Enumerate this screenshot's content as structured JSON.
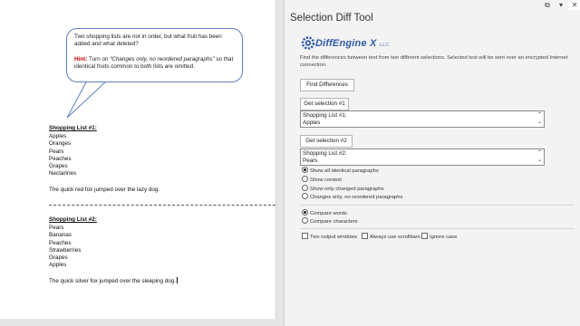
{
  "document": {
    "callout": {
      "line1": "Two shopping lists are not in order, but what fruit has been added and what deleted?",
      "hint_label": "Hint:",
      "hint_pre": " Turn on ",
      "hint_em": "“Changes only, no reordered paragraphs”",
      "hint_post": " so that identical fruits common to both lists are omitted."
    },
    "list1": {
      "heading": "Shopping List #1:",
      "items": [
        "Apples",
        "Oranges",
        "Pears",
        "Peaches",
        "Grapes",
        "Nectarines"
      ],
      "sentence": "The quick red fox jumped over the lazy dog."
    },
    "list2": {
      "heading": "Shopping List #2:",
      "items": [
        "Pears",
        "Bananas",
        "Peaches",
        "Strawberries",
        "Grapes",
        "Apples"
      ],
      "sentence": "The quick silver fox jumped over the sleeping dog."
    }
  },
  "panel": {
    "title": "Selection Diff Tool",
    "window_controls": {
      "restore": "⧉",
      "dropdown": "▾",
      "close": "✕"
    },
    "logo": {
      "name": "DiffEngine X",
      "suffix": "LLC",
      "icon": "gear-icon"
    },
    "description": "Find the differences between text from two different selections. Selected text will be sent over an encrypted Internet connection.",
    "find_button": "Find Differences",
    "selection1": {
      "button": "Get selection #1",
      "line1": "Shopping List #1:",
      "line2": "Apples"
    },
    "selection2": {
      "button": "Get selection #2",
      "line1": "Shopping List #2:",
      "line2": "Pears"
    },
    "display_options": [
      {
        "label": "Show all identical paragraphs",
        "selected": true
      },
      {
        "label": "Show context",
        "selected": false
      },
      {
        "label": "Show only changed paragraphs",
        "selected": false
      },
      {
        "label": "Changes only, no reordered paragraphs",
        "selected": false
      }
    ],
    "compare_options": [
      {
        "label": "Compare words",
        "selected": true
      },
      {
        "label": "Compare characters",
        "selected": false
      }
    ],
    "checkboxes": [
      {
        "label": "Two output windows",
        "checked": false
      },
      {
        "label": "Always use scrollbars",
        "checked": false
      },
      {
        "label": "Ignore case",
        "checked": false
      }
    ],
    "colors": {
      "logo_blue": "#2e5aa8",
      "hint_red": "#c00000",
      "callout_border": "#5b7fbf"
    }
  }
}
